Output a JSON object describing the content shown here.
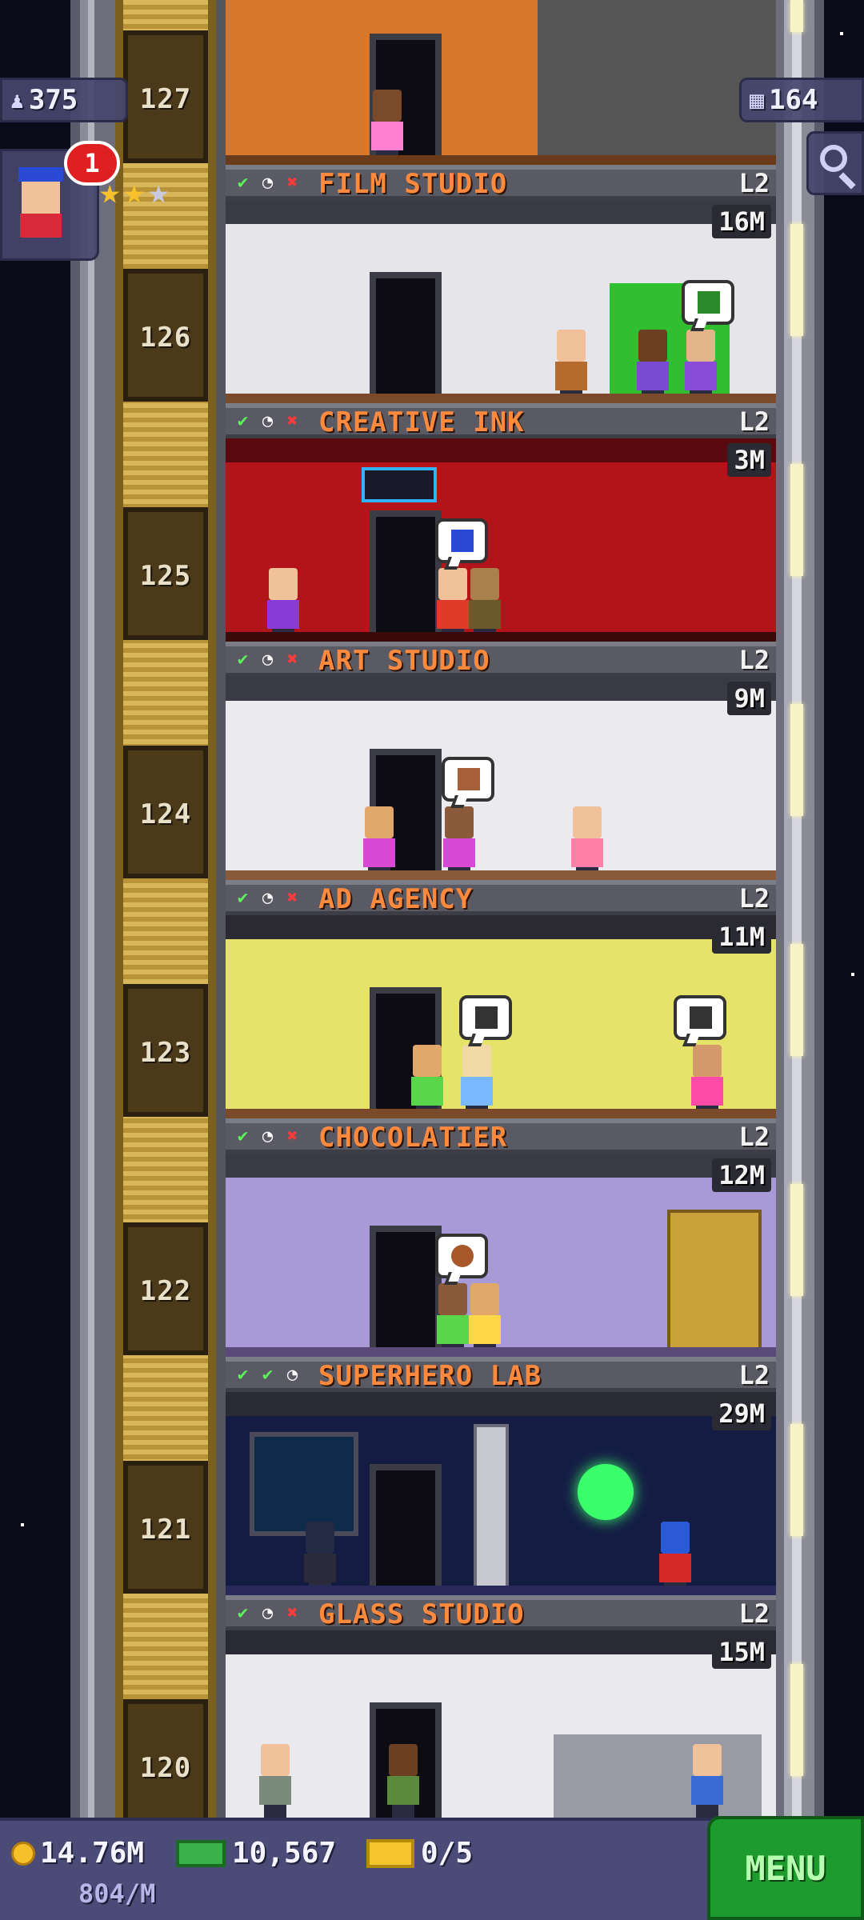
{
  "hud": {
    "population": "375",
    "floors_count": "164",
    "notification_count": "1",
    "vip_stars_filled": 2,
    "vip_stars_total": 3
  },
  "floors": [
    {
      "number": "127",
      "name": "FILM STUDIO",
      "level": "L2",
      "income": "",
      "status": [
        "check",
        "clock",
        "cross"
      ]
    },
    {
      "number": "126",
      "name": "CREATIVE INK",
      "level": "L2",
      "income": "16M",
      "status": [
        "check",
        "clock",
        "cross"
      ]
    },
    {
      "number": "125",
      "name": "ART STUDIO",
      "level": "L2",
      "income": "3M",
      "status": [
        "check",
        "clock",
        "cross"
      ]
    },
    {
      "number": "124",
      "name": "AD AGENCY",
      "level": "L2",
      "income": "9M",
      "status": [
        "check",
        "clock",
        "cross"
      ]
    },
    {
      "number": "123",
      "name": "CHOCOLATIER",
      "level": "L2",
      "income": "11M",
      "status": [
        "check",
        "clock",
        "cross"
      ]
    },
    {
      "number": "122",
      "name": "SUPERHERO LAB",
      "level": "L2",
      "income": "12M",
      "status": [
        "check",
        "check",
        "clock"
      ]
    },
    {
      "number": "121",
      "name": "GLASS STUDIO",
      "level": "L2",
      "income": "29M",
      "status": [
        "check",
        "clock",
        "cross"
      ]
    },
    {
      "number": "120",
      "name": "",
      "level": "",
      "income": "15M",
      "status": []
    }
  ],
  "bottom_bar": {
    "coins": "14.76M",
    "coin_rate": "804/M",
    "bux": "10,567",
    "tickets": "0/5",
    "menu_label": "MENU"
  },
  "colors": {
    "sky": "#0b0a18",
    "label_text": "#ff8a3d",
    "hud_bg": "#4b4b78",
    "menu_bg": "#1d9c2d"
  }
}
